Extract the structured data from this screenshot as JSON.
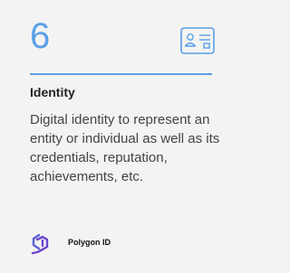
{
  "card": {
    "number": "6",
    "icon": "id-card-icon",
    "title": "Identity",
    "description": "Digital identity to represent an entity or individual as well as its credentials, reputation, achievements, etc.",
    "brand": {
      "name": "Polygon ID",
      "logo": "polygon-id-logo"
    },
    "accent_color": "#5a9fe6",
    "background_color": "#f3f3f3"
  }
}
